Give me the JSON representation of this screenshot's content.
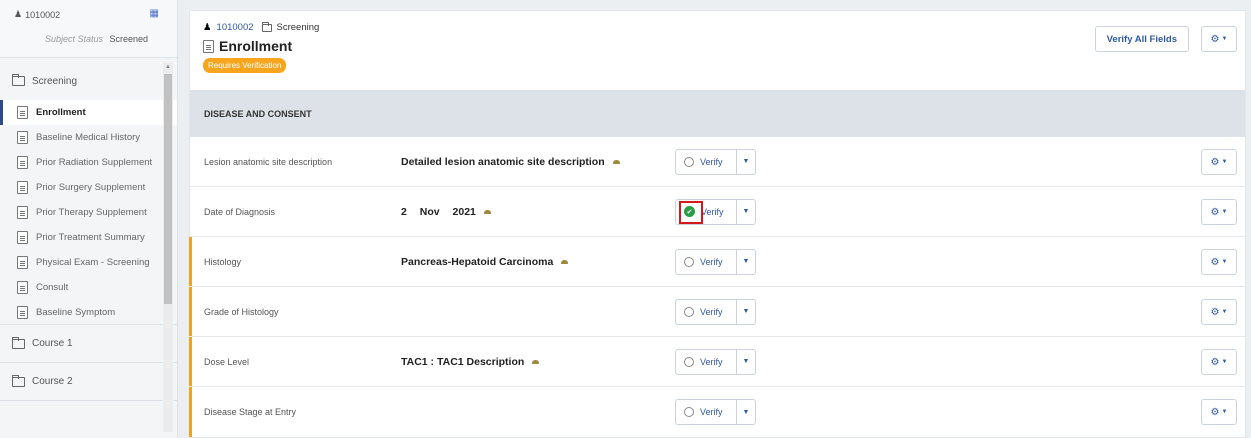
{
  "sidebar": {
    "subject_id": "1010002",
    "status_label": "Subject Status",
    "status_value": "Screened",
    "groups": [
      {
        "label": "Screening"
      },
      {
        "label": "Course 1"
      },
      {
        "label": "Course 2"
      }
    ],
    "items": [
      {
        "label": "Enrollment"
      },
      {
        "label": "Baseline Medical History"
      },
      {
        "label": "Prior Radiation Supplement"
      },
      {
        "label": "Prior Surgery Supplement"
      },
      {
        "label": "Prior Therapy Supplement"
      },
      {
        "label": "Prior Treatment Summary"
      },
      {
        "label": "Physical Exam - Screening"
      },
      {
        "label": "Consult"
      },
      {
        "label": "Baseline Symptom"
      }
    ]
  },
  "header": {
    "subject_id": "1010002",
    "section": "Screening",
    "title": "Enrollment",
    "badge": "Requires Verification",
    "verify_all_label": "Verify All Fields"
  },
  "section_title": "DISEASE AND CONSENT",
  "rows": [
    {
      "label": "Lesion anatomic site description",
      "value": "Detailed lesion anatomic site description",
      "verify_label": "Verify",
      "verified": false
    },
    {
      "label": "Date of Diagnosis",
      "value": "2 Nov 2021",
      "verify_label": "Verify",
      "verified": true
    },
    {
      "label": "Histology",
      "value": "Pancreas-Hepatoid Carcinoma",
      "verify_label": "Verify",
      "verified": false
    },
    {
      "label": "Grade of Histology",
      "value": "",
      "verify_label": "Verify",
      "verified": false
    },
    {
      "label": "Dose Level",
      "value": "TAC1 : TAC1 Description",
      "verify_label": "Verify",
      "verified": false
    },
    {
      "label": "Disease Stage at Entry",
      "value": "",
      "verify_label": "Verify",
      "verified": false
    }
  ],
  "colors": {
    "accent": "#2f5aa8",
    "badge": "#f6a51d",
    "flag": "#f4a21a",
    "verified": "#2a9d47",
    "highlight": "#d11b1b"
  }
}
